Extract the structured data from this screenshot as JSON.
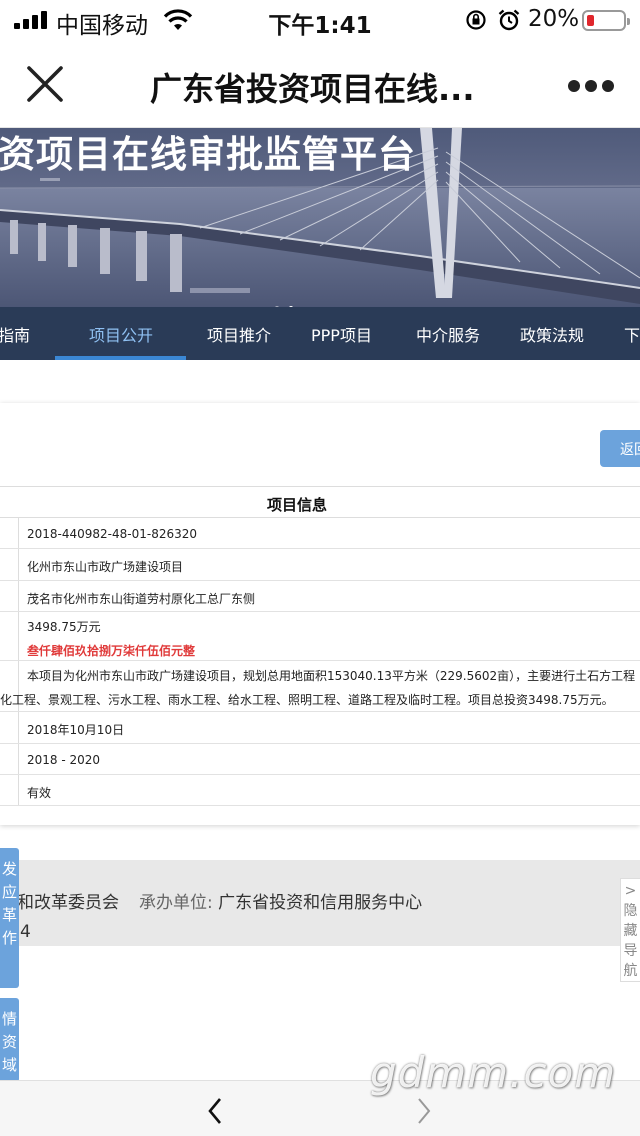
{
  "status_bar": {
    "carrier": "中国移动",
    "time": "下午1:41",
    "battery_percent": "20%",
    "battery_level": 0.2,
    "battery_color": "#e0262c"
  },
  "nav": {
    "title": "广东省投资项目在线..."
  },
  "banner": {
    "title": "资项目在线审批监管平台"
  },
  "menu": {
    "items": [
      "指南",
      "项目公开",
      "项目推介",
      "PPP项目",
      "中介服务",
      "政策法规",
      "下"
    ],
    "active_index": 1,
    "background": "#2a3b57",
    "accent": "#3b87d4"
  },
  "back_button": {
    "label": "返回"
  },
  "table": {
    "header": "项目信息",
    "rows": {
      "project_code": "2018-440982-48-01-826320",
      "project_name": "化州市东山市政广场建设项目",
      "location": "茂名市化州市东山街道劳村原化工总厂东侧",
      "investment": "3498.75万元",
      "investment_capital": "叁仟肆佰玖拾捌万柒仟伍佰元整",
      "desc_line1": "本项目为化州市东山市政广场建设项目，规划总用地面积153040.13平方米（229.5602亩），主要进行土石方工程",
      "desc_line2": "化工程、景观工程、污水工程、雨水工程、给水工程、照明工程、道路工程及临时工程。项目总投资3498.75万元。",
      "date": "2018年10月10日",
      "years": "2018 - 2020",
      "status": "有效"
    }
  },
  "footer": {
    "line1_text": "展和改革委员会",
    "line1_label": "承办单位:",
    "line1_value": "广东省投资和信用服务中心",
    "line2": "4"
  },
  "side_tabs": {
    "tab1": [
      "发",
      "应",
      "革",
      "作"
    ],
    "tab2": [
      "情",
      "资",
      "域"
    ]
  },
  "hide_nav": {
    "arrow": ">",
    "chars": [
      "隐",
      "藏",
      "导",
      "航"
    ]
  },
  "watermark": "gdmm.com"
}
